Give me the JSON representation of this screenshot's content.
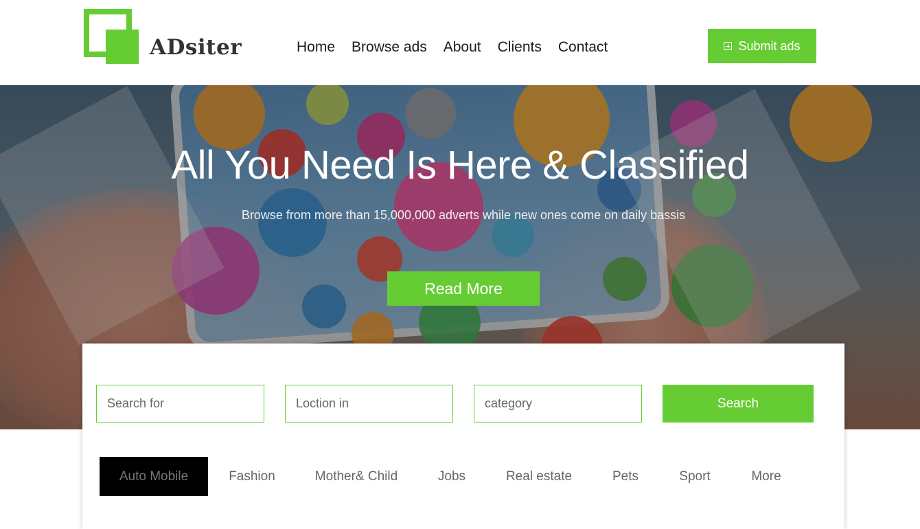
{
  "brand": {
    "name": "ADsiter",
    "color": "#66cc33"
  },
  "nav": {
    "items": [
      "Home",
      "Browse ads",
      "About",
      "Clients",
      "Contact"
    ]
  },
  "header": {
    "submit_label": "Submit ads",
    "submit_icon": "plus-square-icon"
  },
  "hero": {
    "title": "All You Need Is Here & Classified",
    "subtitle": "Browse from more than 15,000,000 adverts while new ones come on daily bassis",
    "cta_label": "Read More"
  },
  "search": {
    "query_placeholder": "Search for",
    "location_placeholder": "Loction in",
    "category_placeholder": "category",
    "button_label": "Search"
  },
  "categories": {
    "active": "Auto Mobile",
    "items": [
      "Auto Mobile",
      "Fashion",
      "Mother& Child",
      "Jobs",
      "Real estate",
      "Pets",
      "Sport",
      "More"
    ]
  }
}
